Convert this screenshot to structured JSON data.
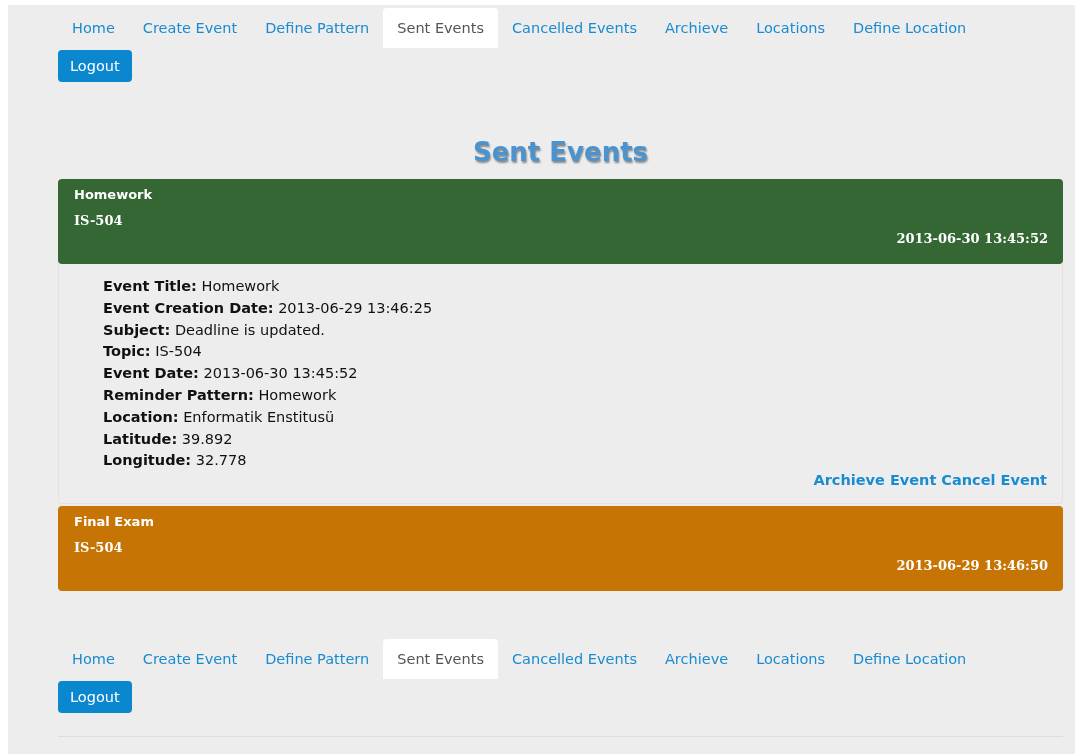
{
  "top_nav": {
    "tabs": [
      {
        "label": "Home",
        "selected": false
      },
      {
        "label": "Create Event",
        "selected": false
      },
      {
        "label": "Define Pattern",
        "selected": false
      },
      {
        "label": "Sent Events",
        "selected": true
      },
      {
        "label": "Cancelled Events",
        "selected": false
      },
      {
        "label": "Archieve",
        "selected": false
      },
      {
        "label": "Locations",
        "selected": false
      },
      {
        "label": "Define Location",
        "selected": false
      }
    ],
    "logout": "Logout"
  },
  "title": "Sent Events",
  "events": [
    {
      "title": "Homework",
      "topic": "IS-504",
      "date": "2013-06-30 13:45:52",
      "color": "#356735",
      "expanded": true,
      "details": [
        {
          "label": "Event Title:",
          "value": "Homework"
        },
        {
          "label": "Event Creation Date:",
          "value": "2013-06-29 13:46:25"
        },
        {
          "label": "Subject:",
          "value": "Deadline is updated."
        },
        {
          "label": "Topic:",
          "value": "IS-504"
        },
        {
          "label": "Event Date:",
          "value": "2013-06-30 13:45:52"
        },
        {
          "label": "Reminder Pattern:",
          "value": "Homework"
        },
        {
          "label": "Location:",
          "value": "Enformatik Enstitusü"
        },
        {
          "label": "Latitude:",
          "value": "39.892"
        },
        {
          "label": "Longitude:",
          "value": "32.778"
        }
      ],
      "actions": [
        "Archieve Event",
        "Cancel Event"
      ]
    },
    {
      "title": "Final Exam",
      "topic": "IS-504",
      "date": "2013-06-29 13:46:50",
      "color": "#c67504",
      "expanded": false
    }
  ],
  "bottom_nav": {
    "tabs": [
      {
        "label": "Home",
        "selected": false
      },
      {
        "label": "Create Event",
        "selected": false
      },
      {
        "label": "Define Pattern",
        "selected": false
      },
      {
        "label": "Sent Events",
        "selected": true
      },
      {
        "label": "Cancelled Events",
        "selected": false
      },
      {
        "label": "Archieve",
        "selected": false
      },
      {
        "label": "Locations",
        "selected": false
      },
      {
        "label": "Define Location",
        "selected": false
      }
    ],
    "logout": "Logout"
  }
}
